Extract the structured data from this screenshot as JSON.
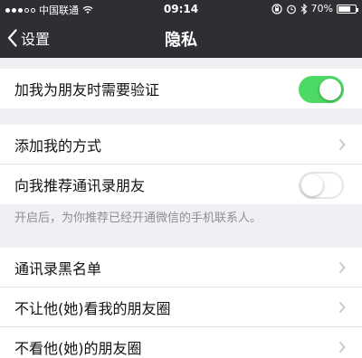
{
  "status_bar": {
    "carrier": "中国联通",
    "time": "09:14",
    "battery": "70%",
    "battery_level": 0.7,
    "icons": [
      "signal-icon",
      "wifi-icon",
      "orientation-lock-icon",
      "alarm-icon",
      "bluetooth-icon",
      "battery-icon"
    ]
  },
  "nav": {
    "back_label": "设置",
    "title": "隐私"
  },
  "group1": {
    "verify": {
      "label": "加我为朋友时需要验证",
      "toggle_on": true
    }
  },
  "group2": {
    "add_methods": {
      "label": "添加我的方式"
    },
    "recommend": {
      "label": "向我推荐通讯录朋友",
      "toggle_on": false
    },
    "hint": "开启后，为你推荐已经开通微信的手机联系人。"
  },
  "group3": {
    "blacklist": {
      "label": "通讯录黑名单"
    },
    "hide_moments": {
      "label": "不让他(她)看我的朋友圈"
    },
    "not_see": {
      "label": "不看他(她)的朋友圈"
    }
  },
  "colors": {
    "nav_bg": "#2e2e33",
    "page_bg": "#efeff4",
    "toggle_on": "#4cd964",
    "chevron": "#c7c7cc"
  }
}
